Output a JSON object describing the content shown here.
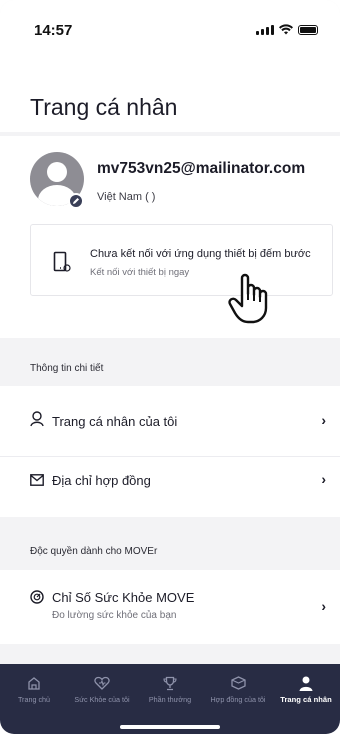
{
  "status_bar": {
    "time": "14:57"
  },
  "header": {
    "title": "Trang cá nhân"
  },
  "profile": {
    "email": "mv753vn25@mailinator.com",
    "country": "Việt Nam ( )"
  },
  "connect_card": {
    "title": "Chưa kết nối với ứng dụng thiết bị đếm bước",
    "subtitle": "Kết nối với thiết bị ngay"
  },
  "details_section": {
    "label": "Thông tin chi tiết",
    "items": [
      {
        "label": "Trang cá nhân của tôi",
        "icon": "person-icon"
      },
      {
        "label": "Địa chỉ hợp đồng",
        "icon": "mail-icon"
      }
    ]
  },
  "exclusive_section": {
    "label": "Độc quyền dành cho MOVEr",
    "items": [
      {
        "label": "Chỉ Số Sức Khỏe MOVE",
        "sublabel": "Đo lường sức khỏe của bạn",
        "icon": "gauge-icon"
      }
    ]
  },
  "tabs": [
    {
      "label": "Trang chủ",
      "icon": "home-icon",
      "active": false
    },
    {
      "label": "Sức Khỏe của tôi",
      "icon": "heart-icon",
      "active": false
    },
    {
      "label": "Phần thưởng",
      "icon": "trophy-icon",
      "active": false
    },
    {
      "label": "Hợp đồng của tôi",
      "icon": "box-icon",
      "active": false
    },
    {
      "label": "Trang cá nhân",
      "icon": "user-icon",
      "active": true
    }
  ],
  "colors": {
    "tabbar_bg": "#282c44",
    "page_bg": "#f3f3f5",
    "text": "#1c1c28"
  }
}
